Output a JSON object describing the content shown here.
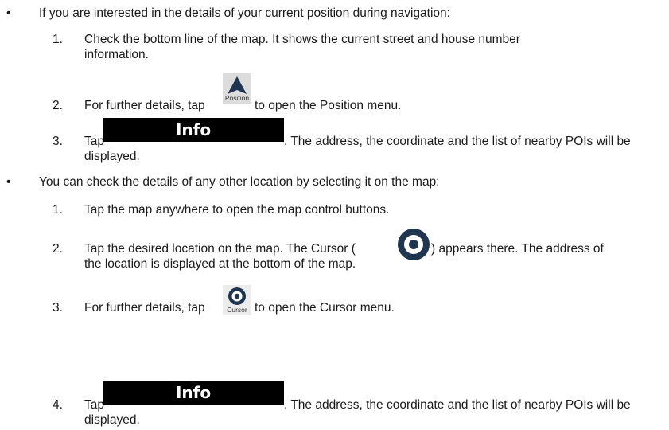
{
  "section1": {
    "bullet_text": "If you are interested in the details of your current position during navigation:",
    "steps": [
      {
        "num": "1.",
        "line1": "Check the bottom line of the map. It shows the current street and house number",
        "line2": "information."
      },
      {
        "num": "2.",
        "before": "For further details, tap",
        "after": "to open the Position menu.",
        "button_label": "Position",
        "icon": "navigation-arrow-icon"
      },
      {
        "num": "3.",
        "before": "Tap",
        "after": ". The address, the coordinate and the list of nearby POIs will be",
        "line2": "displayed.",
        "button_label": "Info"
      }
    ]
  },
  "section2": {
    "bullet_text": "You can check the details of any other location by selecting it on the map:",
    "steps": [
      {
        "num": "1.",
        "line1": "Tap the map anywhere to open the map control buttons."
      },
      {
        "num": "2.",
        "before": "Tap the desired location on the map. The Cursor (",
        "after": ") appears there. The address of",
        "line2": "the location is displayed at the bottom of the map.",
        "icon": "cursor-target-icon"
      },
      {
        "num": "3.",
        "before": "For further details, tap",
        "after": "to open the Cursor menu.",
        "button_label": "Cursor",
        "icon": "cursor-target-icon"
      },
      {
        "num": "4.",
        "before": "Tap",
        "after": ". The address, the coordinate and the list of nearby POIs will be",
        "line2": "displayed.",
        "button_label": "Info"
      }
    ]
  },
  "bullet_char": "•"
}
